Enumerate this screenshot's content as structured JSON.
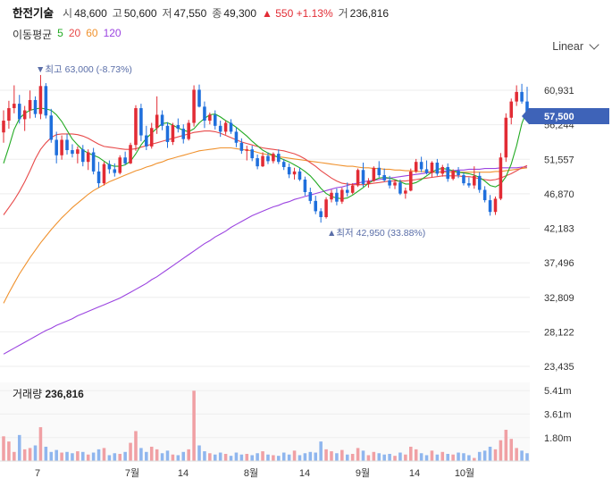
{
  "header": {
    "stock_name": "한전기술",
    "open_label": "시",
    "open": "48,600",
    "high_label": "고",
    "high": "50,600",
    "low_label": "저",
    "low": "47,550",
    "close_label": "종",
    "close": "49,300",
    "change": "▲ 550 +1.13%",
    "volume_label": "거",
    "volume": "236,816"
  },
  "ma_legend": {
    "label": "이동평균",
    "items": [
      {
        "period": "5",
        "color": "#22aa22"
      },
      {
        "period": "20",
        "color": "#e84a4a"
      },
      {
        "period": "60",
        "color": "#f0922e"
      },
      {
        "period": "120",
        "color": "#9b44e0"
      }
    ]
  },
  "scale_selector": "Linear",
  "annotations": {
    "max_text": "▼최고 63,000 (-8.73%)",
    "min_text": "▲최저 42,950 (33.88%)"
  },
  "current_price_tag": "57,500",
  "colors": {
    "up": "#e22c35",
    "down": "#1f6fdc",
    "tag": "#3e63b8",
    "annotation": "#5a6ea8"
  },
  "chart_data": {
    "type": "candlestick",
    "y_ticks": [
      "60,931",
      "56,244",
      "51,557",
      "46,870",
      "42,183",
      "37,496",
      "32,809",
      "28,122",
      "23,435"
    ],
    "y_range": [
      23435,
      60931
    ],
    "x_ticks": [
      "7",
      "7월",
      "14",
      "8월",
      "14",
      "9월",
      "14",
      "10월"
    ],
    "volume": {
      "label": "거래량",
      "current": "236,816",
      "ticks": [
        "5.41m",
        "3.61m",
        "1.80m"
      ],
      "tick_values": [
        5410000,
        3610000,
        1800000
      ]
    },
    "candles": [
      [
        55200,
        58200,
        53800,
        56800
      ],
      [
        56800,
        59500,
        55700,
        58500
      ],
      [
        58500,
        61600,
        57800,
        59100
      ],
      [
        59100,
        60300,
        56400,
        57000
      ],
      [
        57000,
        58800,
        55400,
        58200
      ],
      [
        58200,
        60900,
        57100,
        59600
      ],
      [
        59600,
        60100,
        57200,
        57700
      ],
      [
        57700,
        63000,
        57000,
        61500
      ],
      [
        61500,
        61900,
        57100,
        57500
      ],
      [
        57500,
        58400,
        53800,
        54200
      ],
      [
        54200,
        55300,
        51000,
        52100
      ],
      [
        52100,
        54800,
        51500,
        54200
      ],
      [
        54200,
        55000,
        52200,
        52800
      ],
      [
        52800,
        53600,
        51800,
        52300
      ],
      [
        52300,
        53300,
        51000,
        52900
      ],
      [
        52900,
        53500,
        50600,
        51200
      ],
      [
        51200,
        52900,
        50100,
        52500
      ],
      [
        52500,
        53100,
        49500,
        49900
      ],
      [
        49900,
        51200,
        47700,
        48300
      ],
      [
        48300,
        51200,
        48000,
        50900
      ],
      [
        50900,
        51400,
        49600,
        50200
      ],
      [
        50200,
        51000,
        49200,
        49700
      ],
      [
        49700,
        52100,
        49500,
        51800
      ],
      [
        51800,
        52600,
        50800,
        51000
      ],
      [
        51000,
        53800,
        50900,
        53500
      ],
      [
        53500,
        58900,
        52700,
        58500
      ],
      [
        58500,
        59100,
        54000,
        54800
      ],
      [
        54800,
        56100,
        52800,
        53300
      ],
      [
        53300,
        56500,
        53000,
        55800
      ],
      [
        55800,
        60100,
        55000,
        57600
      ],
      [
        57600,
        58200,
        55500,
        56100
      ],
      [
        56100,
        56600,
        53100,
        53900
      ],
      [
        53900,
        56500,
        53500,
        56200
      ],
      [
        56200,
        57100,
        55200,
        55700
      ],
      [
        55700,
        56300,
        53700,
        54300
      ],
      [
        54300,
        56900,
        54100,
        56500
      ],
      [
        56500,
        61600,
        56000,
        61000
      ],
      [
        61000,
        61700,
        58600,
        58700
      ],
      [
        58700,
        59400,
        55800,
        56800
      ],
      [
        56800,
        57900,
        56300,
        57600
      ],
      [
        57600,
        58200,
        55600,
        56100
      ],
      [
        56100,
        56800,
        54600,
        55300
      ],
      [
        55300,
        56800,
        54900,
        56500
      ],
      [
        56500,
        57000,
        55000,
        55300
      ],
      [
        55300,
        55900,
        53200,
        53800
      ],
      [
        53800,
        54400,
        52300,
        52700
      ],
      [
        52700,
        53400,
        51400,
        52900
      ],
      [
        52900,
        53400,
        51300,
        51700
      ],
      [
        51700,
        52200,
        50200,
        50600
      ],
      [
        50600,
        52500,
        50500,
        52000
      ],
      [
        52000,
        52500,
        50900,
        51300
      ],
      [
        51300,
        52500,
        51000,
        52300
      ],
      [
        52300,
        52900,
        50900,
        51200
      ],
      [
        51200,
        51600,
        50100,
        50500
      ],
      [
        50500,
        51000,
        49000,
        49500
      ],
      [
        49500,
        50400,
        48800,
        49900
      ],
      [
        49900,
        50400,
        48600,
        48800
      ],
      [
        48800,
        49200,
        46600,
        47100
      ],
      [
        47100,
        47700,
        45500,
        45900
      ],
      [
        45900,
        46600,
        44100,
        44500
      ],
      [
        44500,
        44900,
        42950,
        43700
      ],
      [
        43700,
        46400,
        43500,
        46100
      ],
      [
        46100,
        47400,
        45700,
        47000
      ],
      [
        47000,
        47600,
        45300,
        45800
      ],
      [
        45800,
        47700,
        45500,
        47400
      ],
      [
        47400,
        48400,
        46500,
        47000
      ],
      [
        47000,
        48300,
        46800,
        48000
      ],
      [
        48000,
        50300,
        47800,
        50100
      ],
      [
        50100,
        51100,
        47800,
        48200
      ],
      [
        48200,
        49000,
        47700,
        48600
      ],
      [
        48600,
        50600,
        48500,
        50400
      ],
      [
        50400,
        51300,
        49100,
        49400
      ],
      [
        49400,
        50300,
        48500,
        48700
      ],
      [
        48700,
        49300,
        47600,
        48000
      ],
      [
        48000,
        48800,
        47500,
        48400
      ],
      [
        48400,
        48800,
        46700,
        46900
      ],
      [
        46900,
        47700,
        46200,
        47300
      ],
      [
        47300,
        50300,
        47200,
        49900
      ],
      [
        49900,
        51600,
        49700,
        51200
      ],
      [
        51200,
        51900,
        49800,
        50200
      ],
      [
        50200,
        51400,
        49500,
        49700
      ],
      [
        49700,
        51300,
        49100,
        51100
      ],
      [
        51100,
        51600,
        49300,
        49600
      ],
      [
        49600,
        50800,
        49200,
        50500
      ],
      [
        50500,
        51000,
        48500,
        48900
      ],
      [
        48900,
        50200,
        48700,
        50000
      ],
      [
        50000,
        50500,
        49000,
        49400
      ],
      [
        49400,
        49800,
        48000,
        48300
      ],
      [
        48300,
        49100,
        47700,
        48000
      ],
      [
        48000,
        50600,
        47550,
        49300
      ],
      [
        49300,
        49800,
        47000,
        47400
      ],
      [
        47400,
        47900,
        45700,
        46000
      ],
      [
        46000,
        46700,
        43900,
        44400
      ],
      [
        44400,
        46500,
        44000,
        46200
      ],
      [
        46200,
        52400,
        46000,
        51800
      ],
      [
        51800,
        57800,
        51200,
        57200
      ],
      [
        57200,
        59800,
        56300,
        59400
      ],
      [
        59400,
        61600,
        58800,
        60700
      ],
      [
        60700,
        61800,
        59100,
        59400
      ],
      [
        59400,
        61400,
        57100,
        57500
      ]
    ],
    "volumes": [
      1900000,
      1500000,
      700000,
      2000000,
      900000,
      1000000,
      1200000,
      2600000,
      1100000,
      700000,
      850000,
      650000,
      700000,
      600000,
      750000,
      700000,
      500000,
      650000,
      900000,
      1000000,
      450000,
      600000,
      550000,
      700000,
      1400000,
      2300000,
      1000000,
      700000,
      1100000,
      900000,
      600000,
      800000,
      500000,
      450000,
      700000,
      900000,
      5400000,
      1200000,
      750000,
      600000,
      500000,
      650000,
      550000,
      400000,
      650000,
      500000,
      550000,
      450000,
      600000,
      750000,
      500000,
      450000,
      400000,
      650000,
      500000,
      800000,
      450000,
      600000,
      700000,
      650000,
      1500000,
      900000,
      750000,
      600000,
      850000,
      500000,
      550000,
      1000000,
      800000,
      450000,
      700000,
      600000,
      500000,
      550000,
      400000,
      650000,
      500000,
      1100000,
      900000,
      600000,
      450000,
      800000,
      500000,
      700000,
      550000,
      500000,
      650000,
      600000,
      450000,
      236816,
      700000,
      800000,
      1100000,
      900000,
      1600000,
      2400000,
      1700000,
      1000000,
      800000,
      600000
    ],
    "moving_averages": {
      "ma5": [
        51000,
        53200,
        55600,
        57100,
        57800,
        58200,
        58400,
        58500,
        58400,
        58200,
        57600,
        56700,
        55500,
        54300,
        53500,
        52800,
        52400,
        52100,
        51800,
        51300,
        50800,
        50600,
        50600,
        50800,
        51300,
        52300,
        53500,
        54400,
        55100,
        55800,
        56400,
        56500,
        56200,
        55800,
        55500,
        55300,
        55700,
        56500,
        57100,
        57600,
        57700,
        57300,
        56800,
        56400,
        55900,
        55300,
        54700,
        54000,
        53400,
        52800,
        52400,
        52100,
        51800,
        51500,
        51200,
        50800,
        50400,
        49900,
        49300,
        48500,
        47600,
        46900,
        46500,
        46300,
        46200,
        46300,
        46700,
        47200,
        47700,
        48300,
        48700,
        49000,
        49100,
        49000,
        48800,
        48500,
        48200,
        48200,
        48400,
        48800,
        49300,
        49800,
        50200,
        50300,
        50200,
        50000,
        49800,
        49700,
        49600,
        49400,
        49100,
        48600,
        48000,
        47800,
        48200,
        49200,
        50900,
        53400,
        56400,
        58300
      ],
      "ma20": [
        44000,
        45000,
        46000,
        47200,
        48500,
        50000,
        51600,
        52900,
        53800,
        54500,
        54900,
        55000,
        55000,
        55000,
        54900,
        54700,
        54400,
        54000,
        53600,
        53300,
        53200,
        53100,
        53000,
        52900,
        52900,
        53000,
        53200,
        53400,
        53600,
        53800,
        54000,
        54200,
        54400,
        54600,
        54800,
        55000,
        55200,
        55300,
        55400,
        55400,
        55300,
        55100,
        54800,
        54500,
        54200,
        53900,
        53700,
        53500,
        53300,
        53100,
        53000,
        52900,
        52800,
        52700,
        52500,
        52300,
        52000,
        51600,
        51100,
        50600,
        50000,
        49500,
        49000,
        48600,
        48300,
        48200,
        48100,
        48100,
        48100,
        48200,
        48300,
        48400,
        48500,
        48600,
        48600,
        48600,
        48600,
        48700,
        48800,
        48900,
        49000,
        49100,
        49200,
        49300,
        49300,
        49300,
        49300,
        49200,
        49200,
        49100,
        48900,
        48800,
        48700,
        48800,
        49000,
        49300,
        49600,
        50000,
        50400,
        50700
      ],
      "ma60": [
        32000,
        33400,
        34700,
        36000,
        37100,
        38200,
        39200,
        40200,
        41100,
        42000,
        42800,
        43600,
        44300,
        45000,
        45600,
        46200,
        46800,
        47300,
        47700,
        48100,
        48500,
        48800,
        49100,
        49400,
        49700,
        50000,
        50200,
        50500,
        50700,
        51000,
        51200,
        51500,
        51700,
        51900,
        52100,
        52300,
        52500,
        52700,
        52800,
        52900,
        53000,
        53100,
        53100,
        53100,
        53000,
        52900,
        52800,
        52700,
        52500,
        52300,
        52200,
        52000,
        51900,
        51800,
        51700,
        51600,
        51500,
        51400,
        51300,
        51200,
        51100,
        51000,
        50900,
        50800,
        50700,
        50600,
        50600,
        50500,
        50400,
        50400,
        50300,
        50300,
        50200,
        50200,
        50100,
        50100,
        50000,
        50000,
        49900,
        49900,
        49900,
        49800,
        49800,
        49800,
        49800,
        49800,
        49800,
        49800,
        49800,
        49800,
        49800,
        49800,
        49800,
        49900,
        49900,
        50000,
        50100,
        50200,
        50300,
        50400
      ],
      "ma120": [
        25100,
        25500,
        25900,
        26300,
        26700,
        27100,
        27500,
        27900,
        28300,
        28600,
        29000,
        29300,
        29600,
        29900,
        30300,
        30600,
        30900,
        31200,
        31500,
        31800,
        32100,
        32400,
        32700,
        33100,
        33500,
        33900,
        34300,
        34700,
        35200,
        35600,
        36100,
        36600,
        37100,
        37600,
        38100,
        38600,
        39100,
        39600,
        40100,
        40500,
        41000,
        41400,
        41800,
        42300,
        42700,
        43100,
        43500,
        43900,
        44200,
        44500,
        44800,
        45100,
        45300,
        45600,
        45800,
        46100,
        46300,
        46500,
        46700,
        46900,
        47100,
        47300,
        47500,
        47700,
        47800,
        48000,
        48200,
        48300,
        48500,
        48600,
        48700,
        48800,
        48900,
        49000,
        49100,
        49200,
        49300,
        49400,
        49500,
        49600,
        49700,
        49800,
        49800,
        49900,
        50000,
        50000,
        50100,
        50100,
        50200,
        50200,
        50200,
        50300,
        50300,
        50300,
        50400,
        50400,
        50400,
        50400,
        50500,
        50500
      ]
    }
  }
}
